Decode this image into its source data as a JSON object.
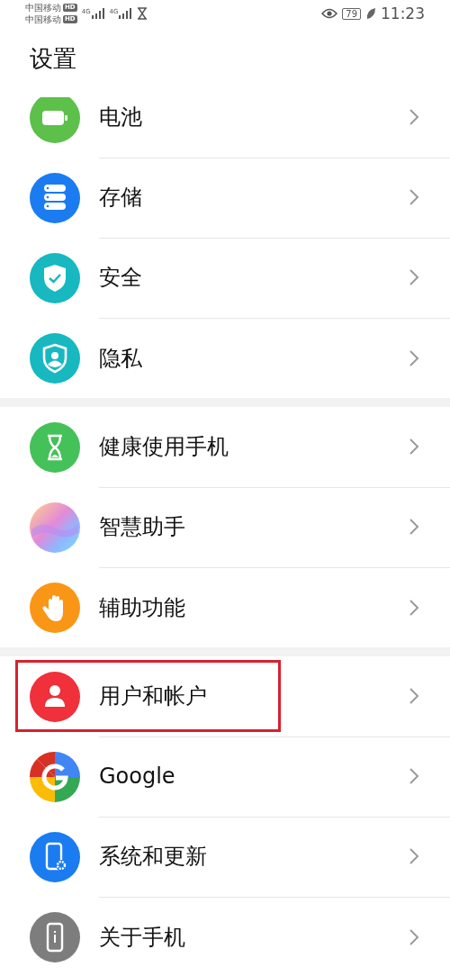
{
  "status_bar": {
    "carriers": [
      {
        "name": "中国移动",
        "badge": "HD"
      },
      {
        "name": "中国移动",
        "badge": "HD"
      }
    ],
    "networks": [
      "4G",
      "4G"
    ],
    "battery": "79",
    "time": "11:23"
  },
  "title": "设置",
  "groups": [
    {
      "items": [
        {
          "label": "电池",
          "kind": "battery",
          "color": "#5cc04a",
          "highlighted": false
        },
        {
          "label": "存储",
          "kind": "storage",
          "color": "#1a7cf0",
          "highlighted": false
        },
        {
          "label": "安全",
          "kind": "shield-check",
          "color": "#17b8c0",
          "highlighted": false
        },
        {
          "label": "隐私",
          "kind": "shield-person",
          "color": "#17b8c0",
          "highlighted": false
        }
      ]
    },
    {
      "items": [
        {
          "label": "健康使用手机",
          "kind": "hourglass",
          "color": "#44c159",
          "highlighted": false
        },
        {
          "label": "智慧助手",
          "kind": "orb",
          "highlighted": false
        },
        {
          "label": "辅助功能",
          "kind": "hand",
          "color": "#fa9616",
          "highlighted": false
        }
      ]
    },
    {
      "items": [
        {
          "label": "用户和帐户",
          "kind": "person",
          "color": "#f0303a",
          "highlighted": true
        },
        {
          "label": "Google",
          "kind": "google",
          "highlighted": false
        },
        {
          "label": "系统和更新",
          "kind": "phone-gear",
          "color": "#1a7cf0",
          "highlighted": false
        },
        {
          "label": "关于手机",
          "kind": "phone-info",
          "color": "#7d7d7d",
          "highlighted": false
        }
      ]
    }
  ]
}
